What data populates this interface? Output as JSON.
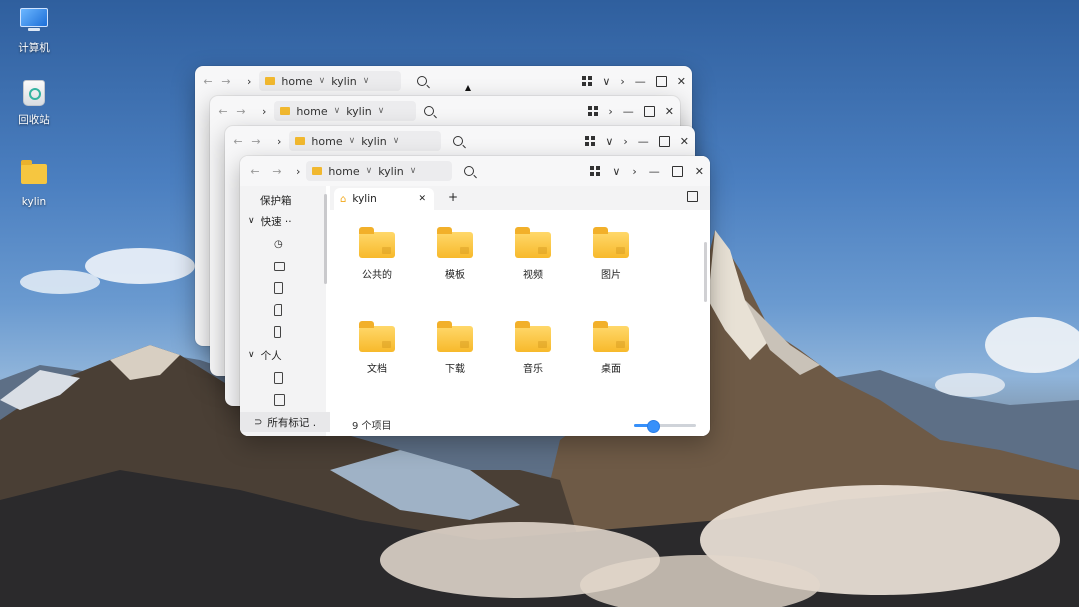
{
  "desktop": {
    "icons": [
      {
        "label": "计算机"
      },
      {
        "label": "回收站"
      },
      {
        "label": "kylin"
      }
    ]
  },
  "file_manager": {
    "breadcrumb": {
      "root": "home",
      "current": "kylin"
    },
    "sidebar": {
      "vault": "保护箱",
      "quick_access": "快速 ··",
      "personal": "个人",
      "all_tags": "所有标记 ."
    },
    "tab": {
      "label": "kylin",
      "new_tab": "+"
    },
    "folders": [
      {
        "label": "公共的"
      },
      {
        "label": "模板"
      },
      {
        "label": "视频"
      },
      {
        "label": "图片"
      },
      {
        "label": "文档"
      },
      {
        "label": "下载"
      },
      {
        "label": "音乐"
      },
      {
        "label": "桌面"
      }
    ],
    "status": "9 个项目",
    "zoom_level": 0.3
  },
  "colors": {
    "accent": "#3790fa",
    "folder": "#f7b92b"
  }
}
